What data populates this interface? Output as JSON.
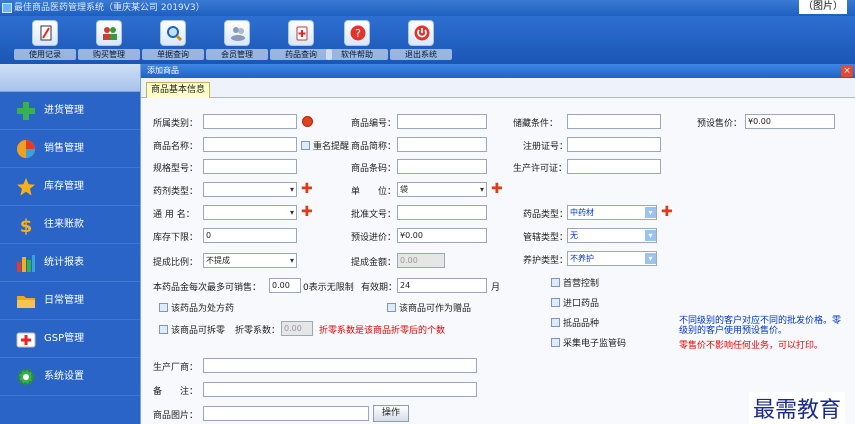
{
  "window": {
    "title": "最佳商品医药管理系统（重庆某公司 2019V3）",
    "top_right": "（图片）"
  },
  "toolbar": {
    "buttons": [
      {
        "label": "使用记录"
      },
      {
        "label": "购买管理"
      },
      {
        "label": "单据查询"
      },
      {
        "label": "会员管理"
      },
      {
        "label": "药品查询"
      },
      {
        "label": "软件帮助"
      },
      {
        "label": "退出系统"
      }
    ]
  },
  "sidebar": {
    "items": [
      {
        "label": "进货管理"
      },
      {
        "label": "销售管理"
      },
      {
        "label": "库存管理"
      },
      {
        "label": "往来账款"
      },
      {
        "label": "统计报表"
      },
      {
        "label": "日常管理"
      },
      {
        "label": "GSP管理"
      },
      {
        "label": "系统设置"
      }
    ]
  },
  "dialog": {
    "title": "添加商品",
    "close": "×",
    "tab": "商品基本信息"
  },
  "form": {
    "category": {
      "label": "所属类别："
    },
    "product_no": {
      "label": "商品编号："
    },
    "storage": {
      "label": "储藏条件："
    },
    "preset_price": {
      "label": "预设售价：",
      "value": "¥0.00"
    },
    "name": {
      "label": "商品名称：",
      "dup_check": "重名提醒"
    },
    "short_name": {
      "label": "商品简称："
    },
    "reg_no": {
      "label": "注册证号："
    },
    "spec": {
      "label": "规格型号："
    },
    "barcode": {
      "label": "商品条码："
    },
    "license": {
      "label": "生产许可证："
    },
    "dosage": {
      "label": "药剂类型："
    },
    "unit": {
      "label": "单　　位：",
      "value": "袋"
    },
    "common_name": {
      "label": "通 用 名："
    },
    "approval": {
      "label": "批准文号："
    },
    "drug_type": {
      "label": "药品类型：",
      "value": "中药材"
    },
    "stock_low": {
      "label": "库存下限：",
      "value": "0"
    },
    "preset_cost": {
      "label": "预设进价：",
      "value": "¥0.00"
    },
    "mgmt_type": {
      "label": "管辖类型：",
      "value": "无"
    },
    "maint_type": {
      "label": "养护类型：",
      "value": "不养护"
    },
    "commission_ratio": {
      "label": "提成比例：",
      "value": "不提成"
    },
    "commission_amount": {
      "label": "提成金额：",
      "value": "0.00"
    },
    "max_sale": {
      "label": "本药品金每次最多可销售：",
      "value": "0.00",
      "hint": "0表示无限制"
    },
    "validity": {
      "label": "有效期：",
      "value": "24",
      "unit": "月"
    },
    "chk_rx": "该药品为处方药",
    "chk_gift": "该商品可作为赠品",
    "chk_split": "该商品可拆零",
    "discount": {
      "label": "折零系数：",
      "value": "0.00"
    },
    "discount_note": "折零系数是该商品折零后的个数",
    "chk_first": "首营控制",
    "chk_import": "进口药品",
    "chk_special": "抵品品种",
    "chk_ecode": "采集电子监管码",
    "note_blue": "不同级别的客户对应不同的批发价格。零级别的客户使用预设售价。",
    "note_red": "零售价不影响任何业务，可以打印。",
    "maker": {
      "label": "生产厂商："
    },
    "remark": {
      "label": "备　　注："
    },
    "image": {
      "label": "商品图片：",
      "button": "操作"
    }
  },
  "watermark": "最需教育"
}
